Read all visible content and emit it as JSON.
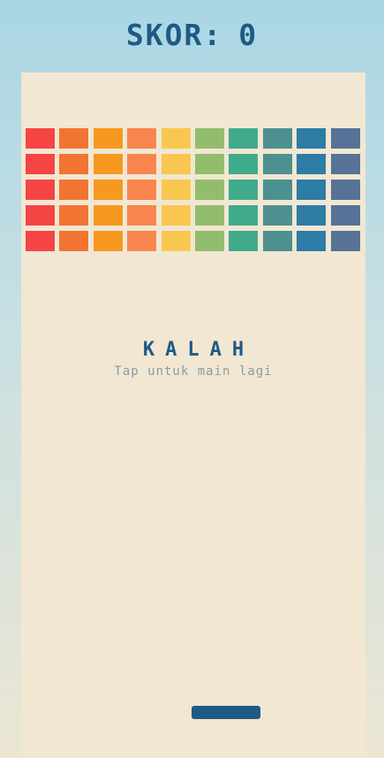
{
  "header": {
    "score_label": "SKOR:",
    "score_value": "0"
  },
  "game": {
    "status_title": "KALAH",
    "status_hint": "Tap untuk main lagi",
    "brick_rows": 5,
    "brick_colors": [
      "#f54545",
      "#f27432",
      "#f7981f",
      "#f8854d",
      "#f9c750",
      "#92bd6d",
      "#40ab8b",
      "#4d9090",
      "#2c7ca6",
      "#577296"
    ]
  },
  "colors": {
    "accent": "#1f5a85",
    "board": "#f1e7d2",
    "hint": "#8d9aa3"
  }
}
